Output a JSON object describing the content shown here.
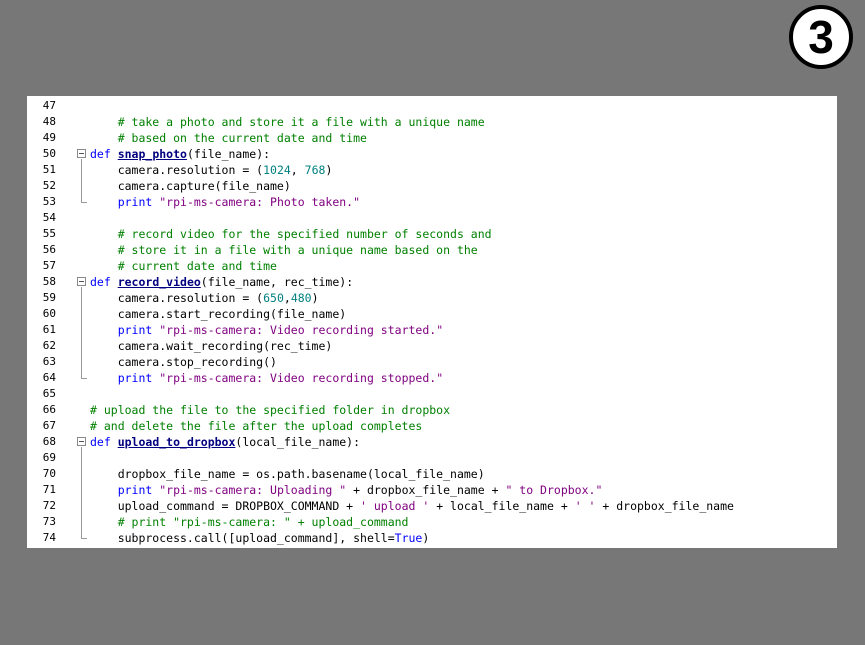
{
  "badge": {
    "label": "3"
  },
  "editor": {
    "lines": [
      {
        "num": "47",
        "tokens": []
      },
      {
        "num": "48",
        "tokens": [
          [
            "comment",
            "    # take a photo and store it a file with a unique name"
          ]
        ]
      },
      {
        "num": "49",
        "tokens": [
          [
            "comment",
            "    # based on the current date and time"
          ]
        ]
      },
      {
        "num": "50",
        "fold": "start",
        "tokens": [
          [
            "keyword",
            "def "
          ],
          [
            "func",
            "snap_photo"
          ],
          [
            "plain",
            "(file_name):"
          ]
        ]
      },
      {
        "num": "51",
        "tokens": [
          [
            "plain",
            "    camera.resolution = ("
          ],
          [
            "number",
            "1024"
          ],
          [
            "plain",
            ", "
          ],
          [
            "number",
            "768"
          ],
          [
            "plain",
            ")"
          ]
        ]
      },
      {
        "num": "52",
        "tokens": [
          [
            "plain",
            "    camera.capture(file_name)"
          ]
        ]
      },
      {
        "num": "53",
        "fold": "end",
        "tokens": [
          [
            "keyword",
            "    print "
          ],
          [
            "string",
            "\"rpi-ms-camera: Photo taken.\""
          ]
        ]
      },
      {
        "num": "54",
        "tokens": []
      },
      {
        "num": "55",
        "tokens": [
          [
            "comment",
            "    # record video for the specified number of seconds and"
          ]
        ]
      },
      {
        "num": "56",
        "tokens": [
          [
            "comment",
            "    # store it in a file with a unique name based on the"
          ]
        ]
      },
      {
        "num": "57",
        "tokens": [
          [
            "comment",
            "    # current date and time"
          ]
        ]
      },
      {
        "num": "58",
        "fold": "start",
        "tokens": [
          [
            "keyword",
            "def "
          ],
          [
            "func",
            "record_video"
          ],
          [
            "plain",
            "(file_name, rec_time):"
          ]
        ]
      },
      {
        "num": "59",
        "tokens": [
          [
            "plain",
            "    camera.resolution = ("
          ],
          [
            "number",
            "650"
          ],
          [
            "plain",
            ","
          ],
          [
            "number",
            "480"
          ],
          [
            "plain",
            ")"
          ]
        ]
      },
      {
        "num": "60",
        "tokens": [
          [
            "plain",
            "    camera.start_recording(file_name)"
          ]
        ]
      },
      {
        "num": "61",
        "tokens": [
          [
            "keyword",
            "    print "
          ],
          [
            "string",
            "\"rpi-ms-camera: Video recording started.\""
          ]
        ]
      },
      {
        "num": "62",
        "tokens": [
          [
            "plain",
            "    camera.wait_recording(rec_time)"
          ]
        ]
      },
      {
        "num": "63",
        "tokens": [
          [
            "plain",
            "    camera.stop_recording()"
          ]
        ]
      },
      {
        "num": "64",
        "fold": "end",
        "tokens": [
          [
            "keyword",
            "    print "
          ],
          [
            "string",
            "\"rpi-ms-camera: Video recording stopped.\""
          ]
        ]
      },
      {
        "num": "65",
        "tokens": []
      },
      {
        "num": "66",
        "tokens": [
          [
            "comment",
            "# upload the file to the specified folder in dropbox"
          ]
        ]
      },
      {
        "num": "67",
        "tokens": [
          [
            "comment",
            "# and delete the file after the upload completes"
          ]
        ]
      },
      {
        "num": "68",
        "fold": "start",
        "tokens": [
          [
            "keyword",
            "def "
          ],
          [
            "func",
            "upload_to_dropbox"
          ],
          [
            "plain",
            "(local_file_name):"
          ]
        ]
      },
      {
        "num": "69",
        "tokens": []
      },
      {
        "num": "70",
        "tokens": [
          [
            "plain",
            "    dropbox_file_name = os.path.basename(local_file_name)"
          ]
        ]
      },
      {
        "num": "71",
        "tokens": [
          [
            "keyword",
            "    print "
          ],
          [
            "string",
            "\"rpi-ms-camera: Uploading \""
          ],
          [
            "plain",
            " + dropbox_file_name + "
          ],
          [
            "string",
            "\" to Dropbox.\""
          ]
        ]
      },
      {
        "num": "72",
        "tokens": [
          [
            "plain",
            "    upload_command = DROPBOX_COMMAND + "
          ],
          [
            "string",
            "' upload '"
          ],
          [
            "plain",
            " + local_file_name + "
          ],
          [
            "string",
            "' '"
          ],
          [
            "plain",
            " + dropbox_file_name"
          ]
        ]
      },
      {
        "num": "73",
        "tokens": [
          [
            "comment",
            "    # print \"rpi-ms-camera: \" + upload_command"
          ]
        ]
      },
      {
        "num": "74",
        "fold": "end",
        "tokens": [
          [
            "plain",
            "    subprocess.call([upload_command], shell="
          ],
          [
            "keyword",
            "True"
          ],
          [
            "plain",
            ")"
          ]
        ]
      }
    ]
  },
  "colors": {
    "background": "#777777",
    "editor_bg": "#ffffff",
    "comment": "#008000",
    "keyword": "#0000ff",
    "function": "#000080",
    "string": "#800080",
    "number": "#008080"
  }
}
